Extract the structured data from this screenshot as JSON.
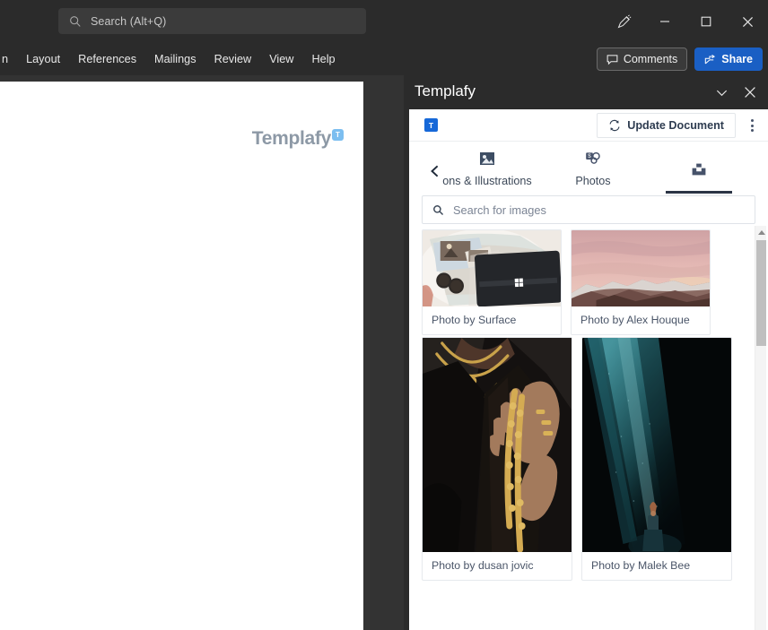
{
  "titlebar": {
    "search_placeholder": "Search (Alt+Q)",
    "search_icon": "search-icon",
    "draw_icon": "pen-draw-icon",
    "minimize_label": "Minimize",
    "maximize_label": "Maximize",
    "close_label": "Close"
  },
  "ribbon": {
    "tabs": [
      {
        "label": "n"
      },
      {
        "label": "Layout"
      },
      {
        "label": "References"
      },
      {
        "label": "Mailings"
      },
      {
        "label": "Review"
      },
      {
        "label": "View"
      },
      {
        "label": "Help"
      }
    ],
    "comments_label": "Comments",
    "share_label": "Share"
  },
  "document": {
    "logo_text": "Templafy",
    "logo_badge": "T"
  },
  "pane": {
    "title": "Templafy",
    "collapse_icon": "chevron-down-icon",
    "close_icon": "close-icon",
    "toolbar": {
      "logo_badge": "T",
      "update_label": "Update Document",
      "update_icon": "refresh-icon",
      "menu_icon": "kebab-menu-icon"
    },
    "back_icon": "chevron-left-icon",
    "tabs": [
      {
        "label": "ons & Illustrations",
        "icon": "image-icon",
        "active": false
      },
      {
        "label": "Photos",
        "icon": "stock-photos-icon",
        "active": false
      },
      {
        "label": "",
        "icon": "upload-icon",
        "active": true
      }
    ],
    "search": {
      "placeholder": "Search for images",
      "icon": "search-icon"
    },
    "images": [
      {
        "caption": "Photo by Surface"
      },
      {
        "caption": "Photo by Alex Houque"
      },
      {
        "caption": "Photo by dusan jovic"
      },
      {
        "caption": "Photo by Malek Bee"
      }
    ]
  },
  "colors": {
    "chrome_dark": "#2b2b2b",
    "share_blue": "#1a5fc4",
    "templafy_blue": "#1668d8",
    "logo_gray": "#8d99a6",
    "tab_navy": "#2b3445"
  }
}
